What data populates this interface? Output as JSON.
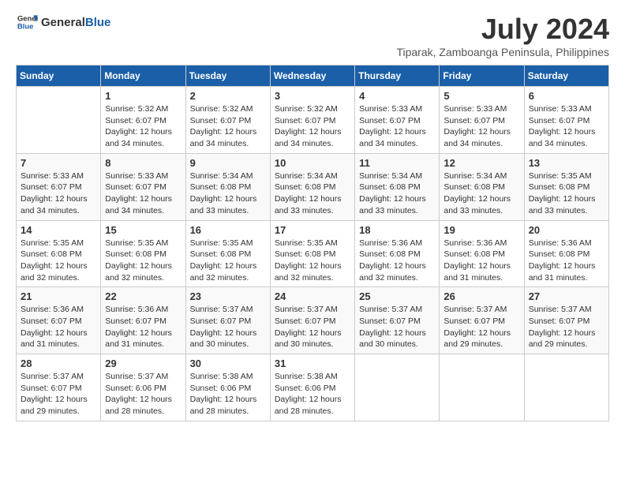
{
  "header": {
    "logo_general": "General",
    "logo_blue": "Blue",
    "month_year": "July 2024",
    "location": "Tiparak, Zamboanga Peninsula, Philippines"
  },
  "days_of_week": [
    "Sunday",
    "Monday",
    "Tuesday",
    "Wednesday",
    "Thursday",
    "Friday",
    "Saturday"
  ],
  "weeks": [
    [
      {
        "day": "",
        "info": ""
      },
      {
        "day": "1",
        "info": "Sunrise: 5:32 AM\nSunset: 6:07 PM\nDaylight: 12 hours\nand 34 minutes."
      },
      {
        "day": "2",
        "info": "Sunrise: 5:32 AM\nSunset: 6:07 PM\nDaylight: 12 hours\nand 34 minutes."
      },
      {
        "day": "3",
        "info": "Sunrise: 5:32 AM\nSunset: 6:07 PM\nDaylight: 12 hours\nand 34 minutes."
      },
      {
        "day": "4",
        "info": "Sunrise: 5:33 AM\nSunset: 6:07 PM\nDaylight: 12 hours\nand 34 minutes."
      },
      {
        "day": "5",
        "info": "Sunrise: 5:33 AM\nSunset: 6:07 PM\nDaylight: 12 hours\nand 34 minutes."
      },
      {
        "day": "6",
        "info": "Sunrise: 5:33 AM\nSunset: 6:07 PM\nDaylight: 12 hours\nand 34 minutes."
      }
    ],
    [
      {
        "day": "7",
        "info": "Sunrise: 5:33 AM\nSunset: 6:07 PM\nDaylight: 12 hours\nand 34 minutes."
      },
      {
        "day": "8",
        "info": "Sunrise: 5:33 AM\nSunset: 6:07 PM\nDaylight: 12 hours\nand 34 minutes."
      },
      {
        "day": "9",
        "info": "Sunrise: 5:34 AM\nSunset: 6:08 PM\nDaylight: 12 hours\nand 33 minutes."
      },
      {
        "day": "10",
        "info": "Sunrise: 5:34 AM\nSunset: 6:08 PM\nDaylight: 12 hours\nand 33 minutes."
      },
      {
        "day": "11",
        "info": "Sunrise: 5:34 AM\nSunset: 6:08 PM\nDaylight: 12 hours\nand 33 minutes."
      },
      {
        "day": "12",
        "info": "Sunrise: 5:34 AM\nSunset: 6:08 PM\nDaylight: 12 hours\nand 33 minutes."
      },
      {
        "day": "13",
        "info": "Sunrise: 5:35 AM\nSunset: 6:08 PM\nDaylight: 12 hours\nand 33 minutes."
      }
    ],
    [
      {
        "day": "14",
        "info": "Sunrise: 5:35 AM\nSunset: 6:08 PM\nDaylight: 12 hours\nand 32 minutes."
      },
      {
        "day": "15",
        "info": "Sunrise: 5:35 AM\nSunset: 6:08 PM\nDaylight: 12 hours\nand 32 minutes."
      },
      {
        "day": "16",
        "info": "Sunrise: 5:35 AM\nSunset: 6:08 PM\nDaylight: 12 hours\nand 32 minutes."
      },
      {
        "day": "17",
        "info": "Sunrise: 5:35 AM\nSunset: 6:08 PM\nDaylight: 12 hours\nand 32 minutes."
      },
      {
        "day": "18",
        "info": "Sunrise: 5:36 AM\nSunset: 6:08 PM\nDaylight: 12 hours\nand 32 minutes."
      },
      {
        "day": "19",
        "info": "Sunrise: 5:36 AM\nSunset: 6:08 PM\nDaylight: 12 hours\nand 31 minutes."
      },
      {
        "day": "20",
        "info": "Sunrise: 5:36 AM\nSunset: 6:08 PM\nDaylight: 12 hours\nand 31 minutes."
      }
    ],
    [
      {
        "day": "21",
        "info": "Sunrise: 5:36 AM\nSunset: 6:07 PM\nDaylight: 12 hours\nand 31 minutes."
      },
      {
        "day": "22",
        "info": "Sunrise: 5:36 AM\nSunset: 6:07 PM\nDaylight: 12 hours\nand 31 minutes."
      },
      {
        "day": "23",
        "info": "Sunrise: 5:37 AM\nSunset: 6:07 PM\nDaylight: 12 hours\nand 30 minutes."
      },
      {
        "day": "24",
        "info": "Sunrise: 5:37 AM\nSunset: 6:07 PM\nDaylight: 12 hours\nand 30 minutes."
      },
      {
        "day": "25",
        "info": "Sunrise: 5:37 AM\nSunset: 6:07 PM\nDaylight: 12 hours\nand 30 minutes."
      },
      {
        "day": "26",
        "info": "Sunrise: 5:37 AM\nSunset: 6:07 PM\nDaylight: 12 hours\nand 29 minutes."
      },
      {
        "day": "27",
        "info": "Sunrise: 5:37 AM\nSunset: 6:07 PM\nDaylight: 12 hours\nand 29 minutes."
      }
    ],
    [
      {
        "day": "28",
        "info": "Sunrise: 5:37 AM\nSunset: 6:07 PM\nDaylight: 12 hours\nand 29 minutes."
      },
      {
        "day": "29",
        "info": "Sunrise: 5:37 AM\nSunset: 6:06 PM\nDaylight: 12 hours\nand 28 minutes."
      },
      {
        "day": "30",
        "info": "Sunrise: 5:38 AM\nSunset: 6:06 PM\nDaylight: 12 hours\nand 28 minutes."
      },
      {
        "day": "31",
        "info": "Sunrise: 5:38 AM\nSunset: 6:06 PM\nDaylight: 12 hours\nand 28 minutes."
      },
      {
        "day": "",
        "info": ""
      },
      {
        "day": "",
        "info": ""
      },
      {
        "day": "",
        "info": ""
      }
    ]
  ]
}
